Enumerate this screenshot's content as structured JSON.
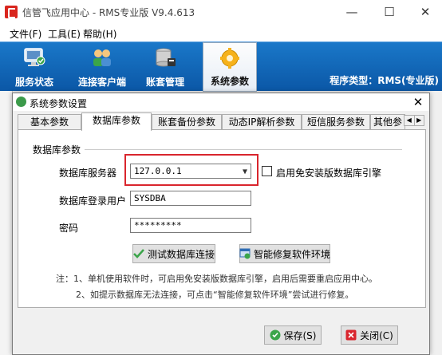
{
  "window": {
    "title": "信管飞应用中心 - RMS专业版 V9.4.613",
    "min_glyph": "—",
    "max_glyph": "☐",
    "close_glyph": "✕"
  },
  "menu": [
    {
      "label": "文件(F)"
    },
    {
      "label": "工具(E)"
    },
    {
      "label": "帮助(H)"
    }
  ],
  "ribbon": {
    "items": [
      {
        "label": "服务状态",
        "icon": "monitor-icon"
      },
      {
        "label": "连接客户端",
        "icon": "users-icon"
      },
      {
        "label": "账套管理",
        "icon": "database-icon"
      },
      {
        "label": "系统参数",
        "icon": "gear-icon",
        "active": true
      }
    ],
    "program_type": "程序类型：RMS(专业版)"
  },
  "dialog": {
    "title": "系统参数设置",
    "close_glyph": "✕",
    "tabs": [
      {
        "label": "基本参数"
      },
      {
        "label": "数据库参数",
        "active": true
      },
      {
        "label": "账套备份参数"
      },
      {
        "label": "动态IP解析参数"
      },
      {
        "label": "短信服务参数"
      },
      {
        "label": "其他参"
      }
    ],
    "tab_scroll": {
      "left": "◀",
      "right": "▶"
    },
    "group_title": "数据库参数",
    "fields": {
      "db_server_label": "数据库服务器",
      "db_server_value": "127.0.0.1",
      "use_free_engine_label": "启用免安装版数据库引擎",
      "use_free_engine_checked": false,
      "db_user_label": "数据库登录用户",
      "db_user_value": "SYSDBA",
      "password_label": "密码",
      "password_value": "*********"
    },
    "buttons": {
      "test_connection": "测试数据库连接",
      "repair_env": "智能修复软件环境",
      "save": "保存(S)",
      "close": "关闭(C)"
    },
    "notes": [
      "注：1、单机使用软件时，可启用免安装版数据库引擎，启用后需要重启应用中心。",
      "2、如提示数据库无法连接，可点击“智能修复软件环境”尝试进行修复。"
    ]
  },
  "colors": {
    "ribbon_blue": "#0b57a6",
    "highlight_red": "#d9252d",
    "logo_red": "#d9251d"
  }
}
